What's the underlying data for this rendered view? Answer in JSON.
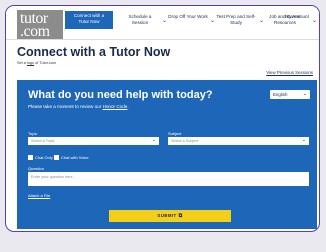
{
  "logo": {
    "line1": "tutor",
    "line2": "com"
  },
  "nav": {
    "items": [
      {
        "label": "Connect with a Tutor Now",
        "active": true
      },
      {
        "label": "Schedule a Session"
      },
      {
        "label": "Drop Off Your Work"
      },
      {
        "label": "Test Prep and Self-Study"
      },
      {
        "label": "Job and Career Resources"
      },
      {
        "label": "My Account"
      }
    ]
  },
  "page": {
    "title": "Connect with a Tutor Now",
    "set_logo_prefix": "Set a ",
    "set_logo_link": "logo",
    "set_logo_suffix": " of Tutor.com",
    "view_previous": "View Previous Sessions"
  },
  "panel": {
    "title": "What do you need help with today?",
    "subtitle_prefix": "Please take a moment to review our ",
    "subtitle_link": "Honor Code",
    "subtitle_suffix": ".",
    "language": "English",
    "topic_label": "Topic",
    "topic_placeholder": "Select a Topic",
    "subject_label": "Subject",
    "subject_placeholder": "Select a Subject",
    "chat_only": "Chat Only",
    "chat_with_voice": "Chat with Voice",
    "question_label": "Question",
    "question_placeholder": "Enter your question here...",
    "attach_file": "Attach a File",
    "submit": "SUBMIT"
  },
  "colors": {
    "brand_blue": "#1e66b8",
    "submit_yellow": "#f4cf1a",
    "frame_purple": "#5b3fa6",
    "logo_gray": "#8c8c8c"
  }
}
